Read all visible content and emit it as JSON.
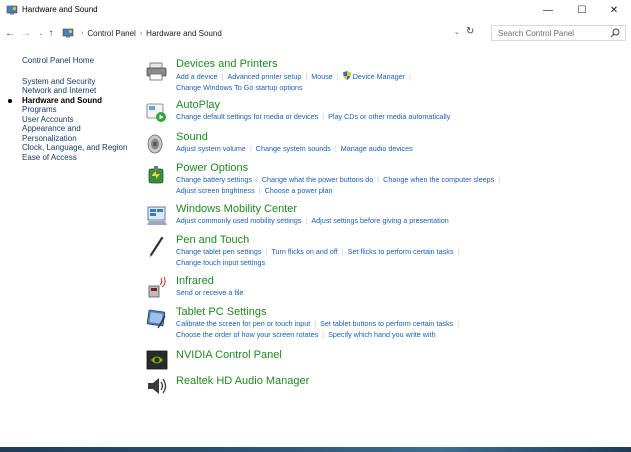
{
  "window": {
    "title": "Hardware and Sound",
    "min_glyph": "—",
    "max_glyph": "☐",
    "close_glyph": "✕"
  },
  "nav": {
    "back_glyph": "←",
    "forward_glyph": "→",
    "recent_glyph": "⌄",
    "up_glyph": "↑",
    "breadcrumbs": [
      "Control Panel",
      "Hardware and Sound"
    ],
    "separator": "›",
    "dropdown_glyph": "⌄",
    "refresh_glyph": "↻",
    "search_placeholder": "Search Control Panel"
  },
  "sidebar": {
    "home": "Control Panel Home",
    "items": [
      {
        "label": "System and Security",
        "current": false
      },
      {
        "label": "Network and Internet",
        "current": false
      },
      {
        "label": "Hardware and Sound",
        "current": true
      },
      {
        "label": "Programs",
        "current": false
      },
      {
        "label": "User Accounts",
        "current": false
      },
      {
        "label": "Appearance and Personalization",
        "current": false
      },
      {
        "label": "Clock, Language, and Region",
        "current": false
      },
      {
        "label": "Ease of Access",
        "current": false
      }
    ]
  },
  "categories": [
    {
      "heading": "Devices and Printers",
      "icon": "printer-icon",
      "rows": [
        [
          "Add a device",
          "Advanced printer setup",
          "Mouse",
          "Device Manager"
        ],
        [
          "Change Windows To Go startup options"
        ]
      ]
    },
    {
      "heading": "AutoPlay",
      "icon": "autoplay-icon",
      "rows": [
        [
          "Change default settings for media or devices",
          "Play CDs or other media automatically"
        ]
      ]
    },
    {
      "heading": "Sound",
      "icon": "speaker-icon",
      "rows": [
        [
          "Adjust system volume",
          "Change system sounds",
          "Manage audio devices"
        ]
      ]
    },
    {
      "heading": "Power Options",
      "icon": "power-icon",
      "rows": [
        [
          "Change battery settings",
          "Change what the power buttons do",
          "Change when the computer sleeps"
        ],
        [
          "Adjust screen brightness",
          "Choose a power plan"
        ]
      ]
    },
    {
      "heading": "Windows Mobility Center",
      "icon": "mobility-icon",
      "rows": [
        [
          "Adjust commonly used mobility settings",
          "Adjust settings before giving a presentation"
        ]
      ]
    },
    {
      "heading": "Pen and Touch",
      "icon": "pen-icon",
      "rows": [
        [
          "Change tablet pen settings",
          "Turn flicks on and off",
          "Set flicks to perform certain tasks"
        ],
        [
          "Change touch input settings"
        ]
      ]
    },
    {
      "heading": "Infrared",
      "icon": "infrared-icon",
      "rows": [
        [
          "Send or receive a file"
        ]
      ]
    },
    {
      "heading": "Tablet PC Settings",
      "icon": "tablet-icon",
      "rows": [
        [
          "Calibrate the screen for pen or touch input",
          "Set tablet buttons to perform certain tasks"
        ],
        [
          "Choose the order of how your screen rotates",
          "Specify which hand you write with"
        ]
      ]
    },
    {
      "heading": "NVIDIA Control Panel",
      "icon": "nvidia-icon",
      "rows": []
    },
    {
      "heading": "Realtek HD Audio Manager",
      "icon": "realtek-speaker-icon",
      "rows": []
    }
  ],
  "colors": {
    "heading": "#1e8a1e",
    "link": "#1b5fb5",
    "sidebar_link": "#1b3a6b"
  }
}
